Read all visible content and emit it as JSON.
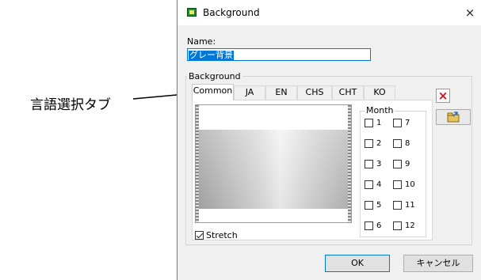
{
  "callout": {
    "label": "言語選択タブ"
  },
  "dialog": {
    "title": "Background",
    "close_glyph": "×",
    "name_label": "Name:",
    "name_value": "グレー背景",
    "group_label": "Background",
    "tabs": [
      {
        "label": "Common",
        "active": true
      },
      {
        "label": "JA"
      },
      {
        "label": "EN"
      },
      {
        "label": "CHS"
      },
      {
        "label": "CHT"
      },
      {
        "label": "KO"
      }
    ],
    "month": {
      "legend": "Month",
      "items": [
        {
          "num": "1",
          "checked": false
        },
        {
          "num": "2",
          "checked": false
        },
        {
          "num": "3",
          "checked": false
        },
        {
          "num": "4",
          "checked": false
        },
        {
          "num": "5",
          "checked": false
        },
        {
          "num": "6",
          "checked": false
        },
        {
          "num": "7",
          "checked": false
        },
        {
          "num": "8",
          "checked": false
        },
        {
          "num": "9",
          "checked": false
        },
        {
          "num": "10",
          "checked": false
        },
        {
          "num": "11",
          "checked": false
        },
        {
          "num": "12",
          "checked": false
        }
      ]
    },
    "stretch": {
      "label": "Stretch",
      "checked": true
    },
    "delete_icon": "×",
    "buttons": {
      "ok": "OK",
      "cancel": "キャンセル"
    }
  },
  "colors": {
    "accent": "#0078d7",
    "delete": "#c8141e"
  },
  "icons": [
    "window-app-icon",
    "close-icon",
    "delete-icon",
    "import-image-icon",
    "callout-arrow-icon"
  ]
}
